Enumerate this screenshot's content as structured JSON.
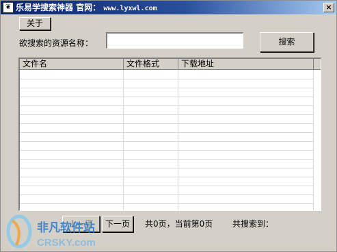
{
  "window": {
    "title": "乐易学搜索神器  官网：",
    "url": "www.lyxwl.com",
    "app_icon_text": "❦",
    "close_symbol": "×"
  },
  "toolbar": {
    "about_label": "关于"
  },
  "search": {
    "label": "欲搜索的资源名称：",
    "value": "",
    "button_label": "搜索"
  },
  "table": {
    "columns": [
      "文件名",
      "文件格式",
      "下载地址"
    ],
    "rows": []
  },
  "pager": {
    "prev_label": "上一页",
    "next_label": "下一页",
    "page_info": "共0页，当前第0页",
    "result_info": "共搜索到："
  },
  "watermark": {
    "brand_cn": "非凡软件站",
    "brand_en": "CRSKY.com"
  }
}
